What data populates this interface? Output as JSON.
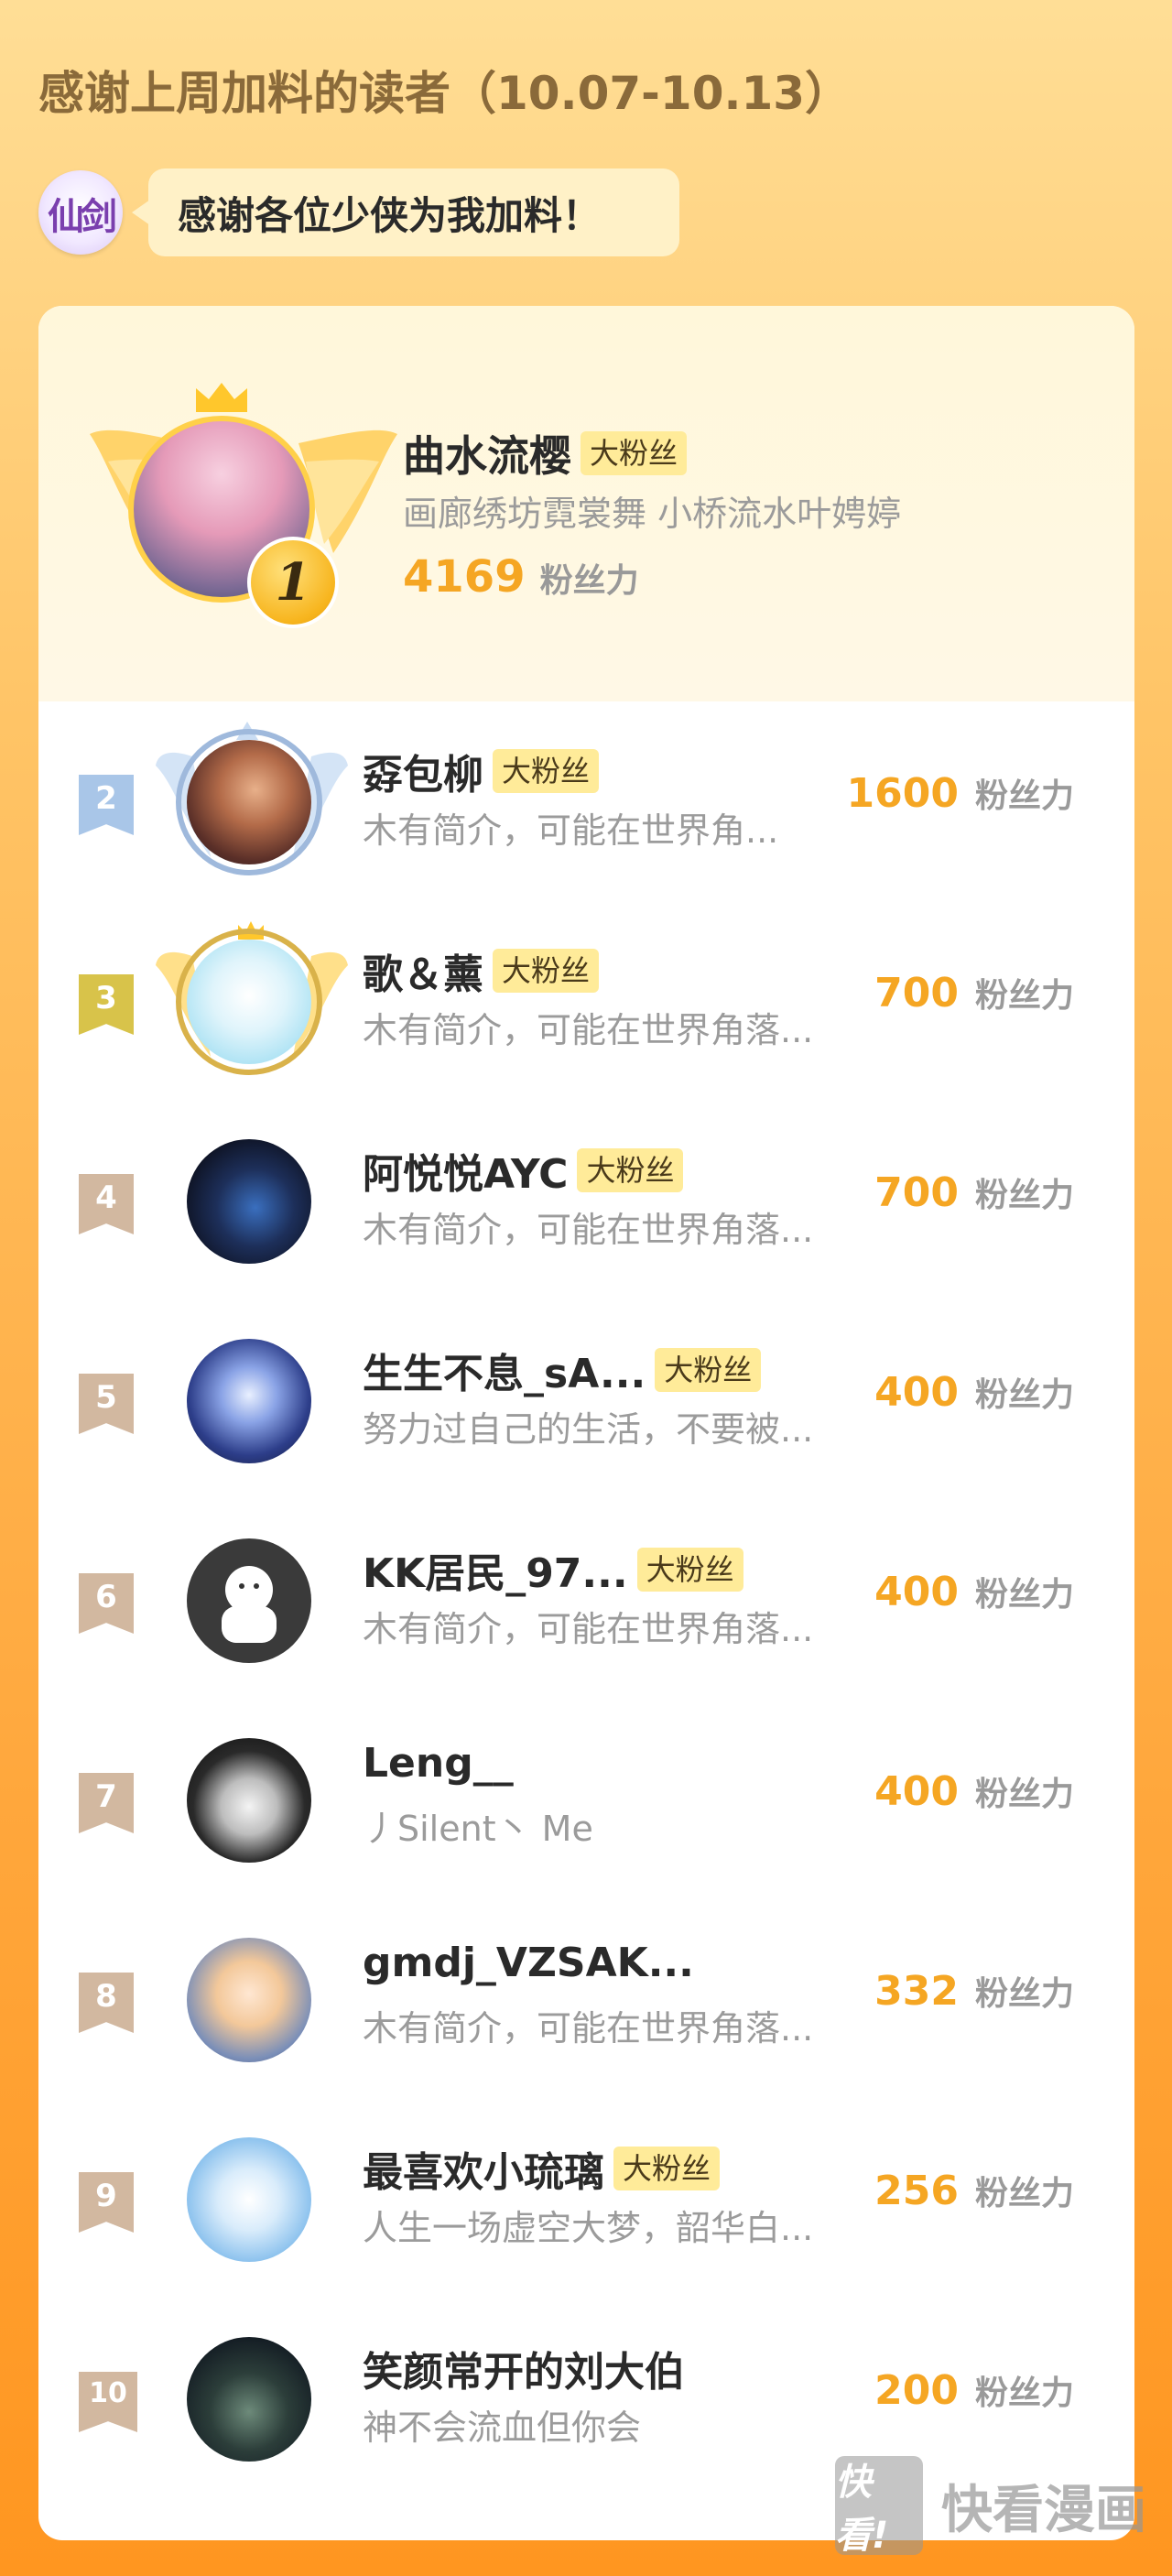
{
  "header": {
    "title": "感谢上周加料的读者（10.07-10.13）",
    "brand_logo_text": "仙剑",
    "bubble_text": "感谢各位少侠为我加料！"
  },
  "top_fan": {
    "rank": "1",
    "name": "曲水流樱",
    "badge": "大粉丝",
    "bio": "画廊绣坊霓裳舞 小桥流水叶娉婷",
    "score": "4169",
    "unit": "粉丝力"
  },
  "fans": [
    {
      "rank": "2",
      "name": "孬包柳",
      "badge": "大粉丝",
      "bio": "木有简介，可能在世界角...",
      "score": "1600",
      "unit": "粉丝力"
    },
    {
      "rank": "3",
      "name": "歌＆薰",
      "badge": "大粉丝",
      "bio": "木有简介，可能在世界角落...",
      "score": "700",
      "unit": "粉丝力"
    },
    {
      "rank": "4",
      "name": "阿悦悦AYC",
      "badge": "大粉丝",
      "bio": "木有简介，可能在世界角落...",
      "score": "700",
      "unit": "粉丝力"
    },
    {
      "rank": "5",
      "name": "生生不息_sA...",
      "badge": "大粉丝",
      "bio": "努力过自己的生活，不要被...",
      "score": "400",
      "unit": "粉丝力"
    },
    {
      "rank": "6",
      "name": "KK居民_97...",
      "badge": "大粉丝",
      "bio": "木有简介，可能在世界角落...",
      "score": "400",
      "unit": "粉丝力"
    },
    {
      "rank": "7",
      "name": "Leng__",
      "badge": "",
      "bio": "丿Silent丶 Me",
      "score": "400",
      "unit": "粉丝力"
    },
    {
      "rank": "8",
      "name": "gmdj_VZSAK...",
      "badge": "",
      "bio": "木有简介，可能在世界角落...",
      "score": "332",
      "unit": "粉丝力"
    },
    {
      "rank": "9",
      "name": "最喜欢小琉璃",
      "badge": "大粉丝",
      "bio": "人生一场虚空大梦，韶华白...",
      "score": "256",
      "unit": "粉丝力"
    },
    {
      "rank": "10",
      "name": "笑颜常开的刘大伯",
      "badge": "",
      "bio": "神不会流血但你会",
      "score": "200",
      "unit": "粉丝力"
    }
  ],
  "watermark": {
    "box_text": "快看!",
    "text": "快看漫画"
  },
  "colors": {
    "accent": "#F5A623",
    "rank2": "#A9C6E8",
    "rank3": "#D8C34A",
    "rank_other": "#D2B8A0"
  }
}
